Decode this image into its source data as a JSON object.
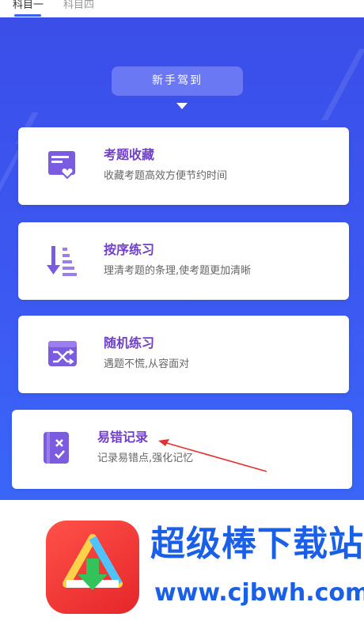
{
  "tabs": [
    {
      "label": "科目一"
    },
    {
      "label": "科目四"
    }
  ],
  "badge": {
    "label": "新手驾到"
  },
  "cards": [
    {
      "title": "考题收藏",
      "desc": "收藏考题高效方便节约时间",
      "icon": "favorite-questions-icon"
    },
    {
      "title": "按序练习",
      "desc": "理清考题的条理,使考题更加清晰",
      "icon": "sequential-practice-icon"
    },
    {
      "title": "随机练习",
      "desc": "遇题不慌,从容面对",
      "icon": "shuffle-icon"
    },
    {
      "title": "易错记录",
      "desc": "记录易错点,强化记忆",
      "icon": "mistake-record-icon"
    }
  ],
  "watermark": {
    "brand": "超级棒下载站",
    "url": "www.cjbwh.com"
  },
  "colors": {
    "panel": "#3b52ee",
    "accent": "#7040c8",
    "brand": "#1a5fe8",
    "logo": "#e5262a"
  }
}
